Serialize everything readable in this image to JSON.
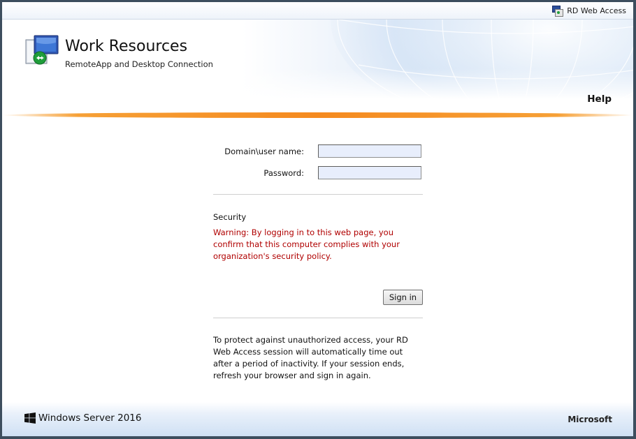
{
  "topbar": {
    "brand_label": "RD Web Access",
    "brand_icon": "rd-web-access-icon"
  },
  "header": {
    "title": "Work Resources",
    "subtitle": "RemoteApp and Desktop Connection",
    "help_label": "Help",
    "logo_icon": "remoteapp-computer-icon"
  },
  "login": {
    "username_label": "Domain\\user name:",
    "username_value": "",
    "password_label": "Password:",
    "password_value": "",
    "security_heading": "Security",
    "security_warning": "Warning: By logging in to this web page, you confirm that this computer complies with your organization's security policy.",
    "signin_label": "Sign in",
    "timeout_note": "To protect against unauthorized access, your RD Web Access session will automatically time out after a period of inactivity. If your session ends, refresh your browser and sign in again."
  },
  "footer": {
    "os_name": "Windows Server 2016",
    "vendor": "Microsoft",
    "os_icon": "windows-logo-icon"
  },
  "colors": {
    "warning_text": "#b00000",
    "accent_orange": "#f58a1f",
    "input_background": "#e8eefc"
  }
}
